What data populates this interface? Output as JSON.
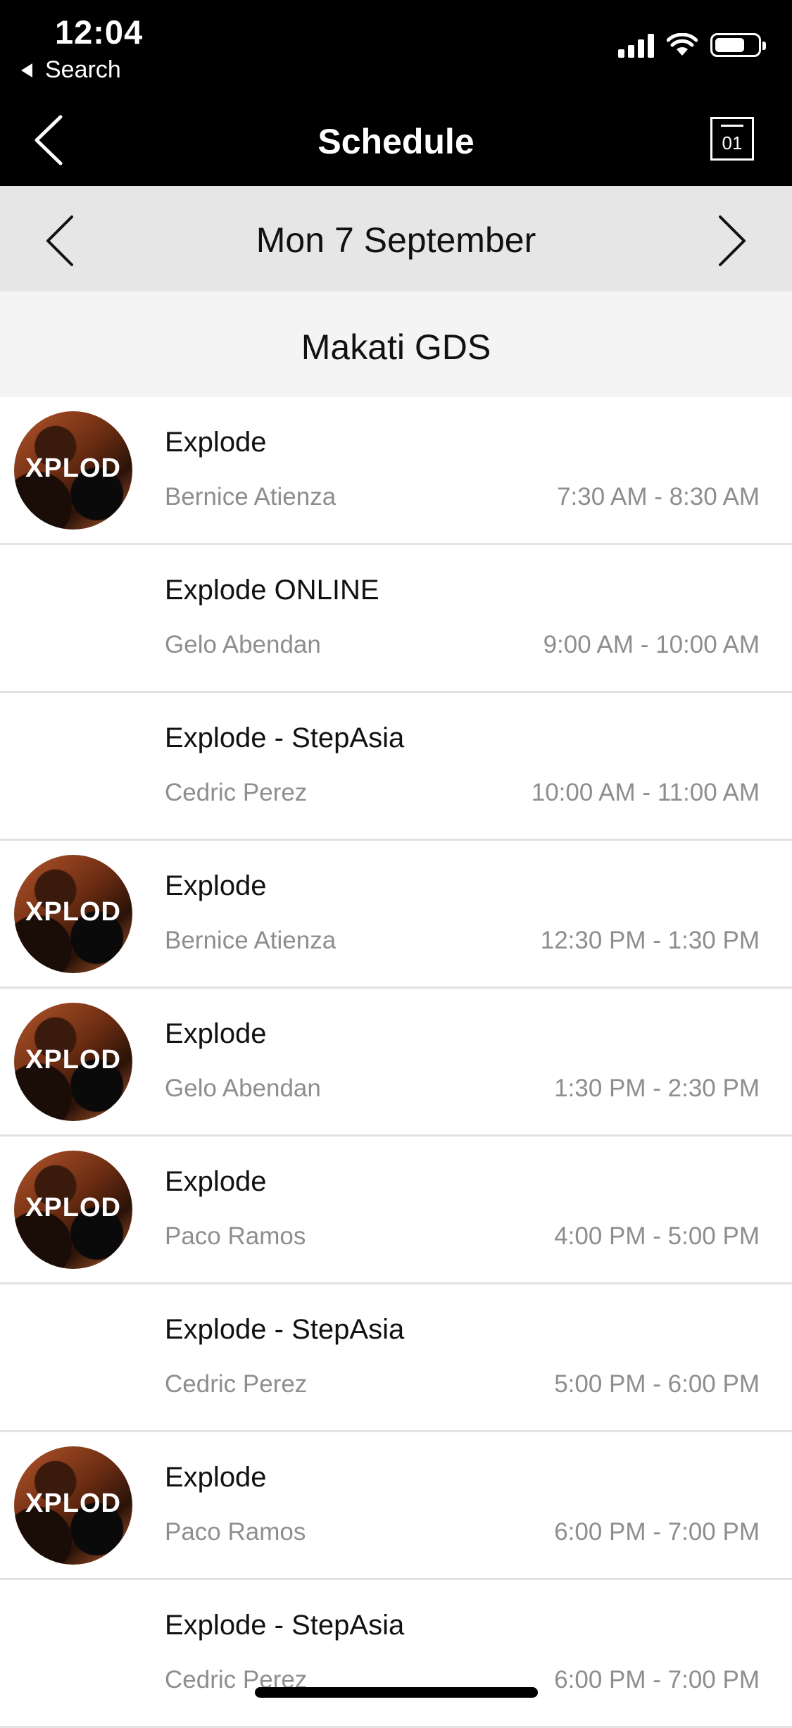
{
  "status_bar": {
    "time": "12:04",
    "back_label": "Search"
  },
  "header": {
    "title": "Schedule",
    "calendar_day": "01"
  },
  "date_nav": {
    "date": "Mon 7 September"
  },
  "location": {
    "name": "Makati GDS"
  },
  "avatar_text": "XPLOD",
  "classes": [
    {
      "name": "Explode",
      "instructor": "Bernice Atienza",
      "time": "7:30 AM - 8:30 AM",
      "has_avatar": true
    },
    {
      "name": "Explode ONLINE",
      "instructor": "Gelo Abendan",
      "time": "9:00 AM - 10:00 AM",
      "has_avatar": false
    },
    {
      "name": "Explode - StepAsia",
      "instructor": "Cedric Perez",
      "time": "10:00 AM - 11:00 AM",
      "has_avatar": false
    },
    {
      "name": "Explode",
      "instructor": "Bernice Atienza",
      "time": "12:30 PM - 1:30 PM",
      "has_avatar": true
    },
    {
      "name": "Explode",
      "instructor": "Gelo Abendan",
      "time": "1:30 PM - 2:30 PM",
      "has_avatar": true
    },
    {
      "name": "Explode",
      "instructor": "Paco Ramos",
      "time": "4:00 PM - 5:00 PM",
      "has_avatar": true
    },
    {
      "name": "Explode - StepAsia",
      "instructor": "Cedric Perez",
      "time": "5:00 PM - 6:00 PM",
      "has_avatar": false
    },
    {
      "name": "Explode",
      "instructor": "Paco Ramos",
      "time": "6:00 PM - 7:00 PM",
      "has_avatar": true
    },
    {
      "name": "Explode - StepAsia",
      "instructor": "Cedric Perez",
      "time": "6:00 PM - 7:00 PM",
      "has_avatar": false
    }
  ]
}
